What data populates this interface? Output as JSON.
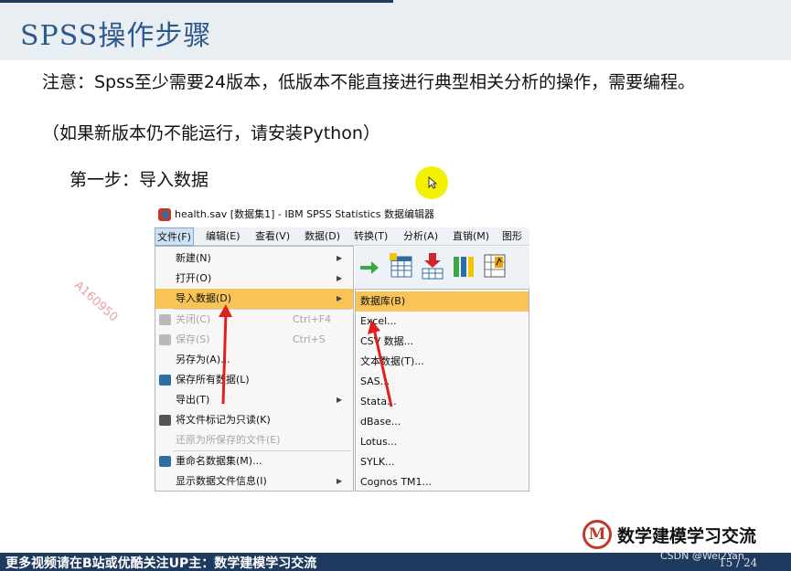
{
  "slide": {
    "title": "SPSS操作步骤",
    "note_line1": "注意：Spss至少需要24版本，低版本不能直接进行典型相关分析的操作，需要编程。",
    "note_line2": "（如果新版本仍不能运行，请安装Python）",
    "step_text": "第一步：导入数据"
  },
  "spss": {
    "window_title": "health.sav [数据集1] - IBM SPSS Statistics 数据编辑器",
    "menubar": [
      "文件(F)",
      "编辑(E)",
      "查看(V)",
      "数据(D)",
      "转换(T)",
      "分析(A)",
      "直销(M)",
      "图形(G"
    ],
    "file_menu": [
      {
        "label": "新建(N)",
        "shortcut": "",
        "disabled": false
      },
      {
        "label": "打开(O)",
        "shortcut": "",
        "disabled": false
      },
      {
        "label": "导入数据(D)",
        "shortcut": "",
        "disabled": false
      },
      {
        "label": "关闭(C)",
        "shortcut": "Ctrl+F4",
        "disabled": true
      },
      {
        "label": "保存(S)",
        "shortcut": "Ctrl+S",
        "disabled": true
      },
      {
        "label": "另存为(A)...",
        "shortcut": "",
        "disabled": false
      },
      {
        "label": "保存所有数据(L)",
        "shortcut": "",
        "disabled": false
      },
      {
        "label": "导出(T)",
        "shortcut": "",
        "disabled": false
      },
      {
        "label": "将文件标记为只读(K)",
        "shortcut": "",
        "disabled": false
      },
      {
        "label": "还原为所保存的文件(E)",
        "shortcut": "",
        "disabled": true
      },
      {
        "label": "重命名数据集(M)...",
        "shortcut": "",
        "disabled": false
      },
      {
        "label": "显示数据文件信息(I)",
        "shortcut": "",
        "disabled": false
      }
    ],
    "import_submenu": [
      "数据库(B)",
      "Excel...",
      "CSV 数据...",
      "文本数据(T)...",
      "SAS...",
      "Stata...",
      "dBase...",
      "Lotus...",
      "SYLK...",
      "Cognos TM1..."
    ],
    "watermark": "A160950"
  },
  "branding": {
    "logo_letter": "M",
    "logo_text": "数学建模学习交流",
    "footer_text": "更多视频请在B站或优酷关注UP主：数学建模学习交流",
    "csdn": "CSDN @Wei2Yan",
    "page_number": "15 / 24"
  },
  "colors": {
    "title_blue": "#2c5a8c",
    "footer_navy": "#1f3a5f",
    "menu_highlight": "#f7c455",
    "pointer_yellow": "#f5f000",
    "arrow_red": "#e02020"
  }
}
